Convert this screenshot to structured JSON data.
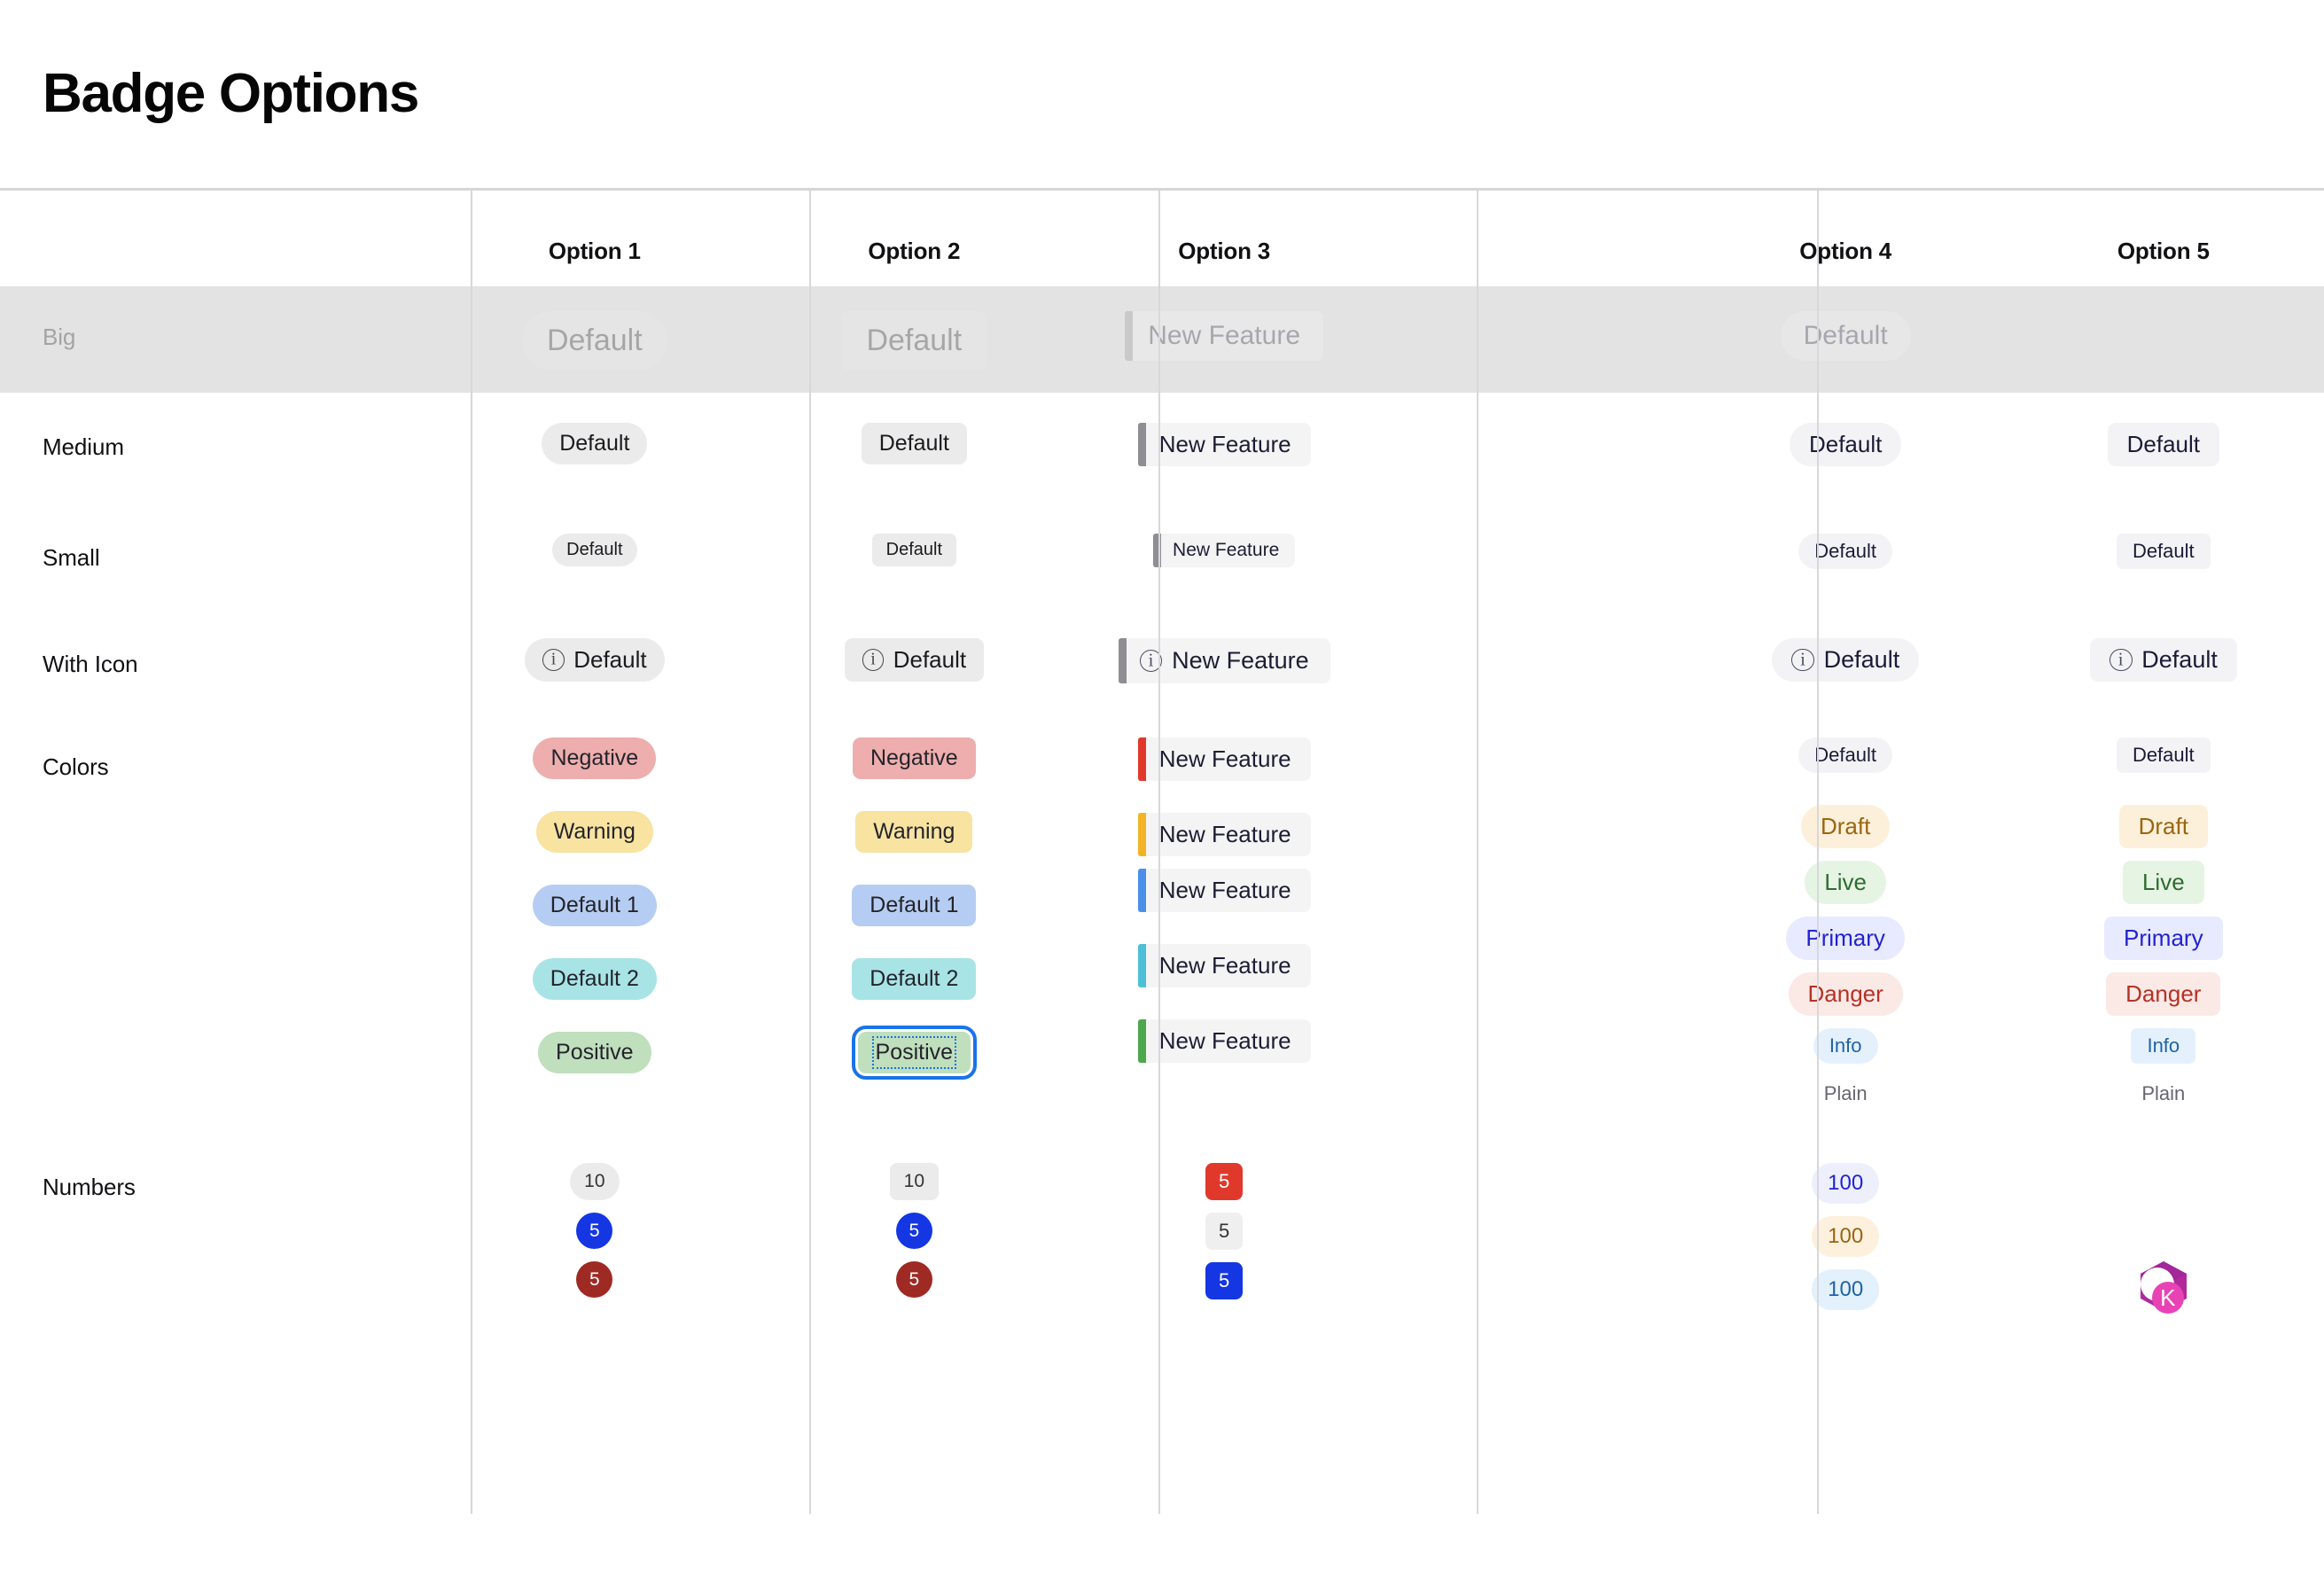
{
  "page": {
    "title": "Badge Options"
  },
  "columns": [
    {
      "label": ""
    },
    {
      "label": "Option 1"
    },
    {
      "label": "Option 2"
    },
    {
      "label": "Option 3"
    },
    {
      "label": ""
    },
    {
      "label": "Option 4"
    },
    {
      "label": "Option 5"
    }
  ],
  "rows": {
    "big": {
      "label": "Big"
    },
    "medium": {
      "label": "Medium"
    },
    "small": {
      "label": "Small"
    },
    "withicon": {
      "label": "With Icon"
    },
    "colors": {
      "label": "Colors"
    },
    "numbers": {
      "label": "Numbers"
    }
  },
  "labels": {
    "default": "Default",
    "new_feature": "New Feature",
    "negative": "Negative",
    "warning": "Warning",
    "default1": "Default 1",
    "default2": "Default 2",
    "positive": "Positive",
    "draft": "Draft",
    "live": "Live",
    "primary": "Primary",
    "danger": "Danger",
    "info": "Info",
    "plain": "Plain",
    "info_icon_glyph": "i",
    "avatar_initial": "K"
  },
  "numbers": {
    "ten": "10",
    "five": "5",
    "hundred": "100"
  },
  "colors": {
    "badge_grey_bg": "#ebebeb",
    "badge_soft_bg": "#f3f3f6",
    "row_hover_bg": "#e3e3e3",
    "divider": "#d8d8dc",
    "negative": "#eeaeae",
    "warning": "#f8e3a1",
    "default1": "#b6cdf3",
    "default2": "#a8e4e6",
    "positive": "#bfdfbd",
    "focus_ring": "#1a73e8",
    "bar_grey": "#8e8e93",
    "bar_red": "#e0392c",
    "bar_amber": "#f2b424",
    "bar_blue": "#4a90e8",
    "bar_cyan": "#4dc0d8",
    "bar_green": "#4da84d",
    "draft_text": "#9a6511",
    "live_text": "#2f6b30",
    "primary_text": "#2222d0",
    "danger_text": "#b53225",
    "info_text": "#1f63a8",
    "plain_text": "#666670",
    "num_blue": "#1536e3",
    "num_crimson": "#9e2a23",
    "num_red": "#e0392c",
    "avatar_pink": "#e843b4",
    "avatar_magenta": "#b02a9c"
  }
}
